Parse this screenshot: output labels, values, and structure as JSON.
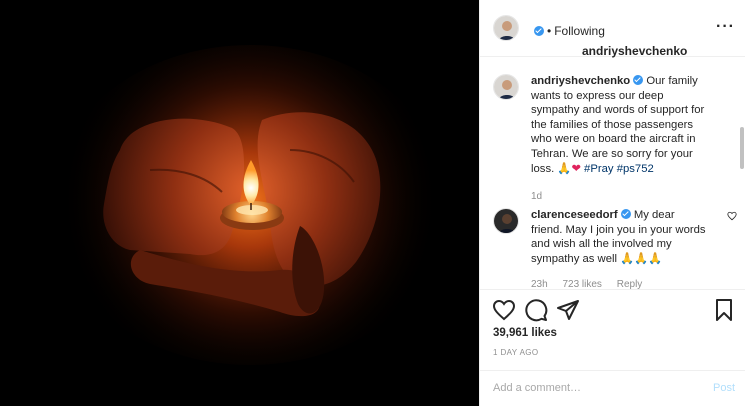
{
  "post": {
    "author": "andriyshevchenko",
    "follow_status": "Following",
    "more_icon": "more-options-icon"
  },
  "caption": {
    "author": "andriyshevchenko",
    "text": "Our family wants to express our deep sympathy and words of support for the families of those passengers who were on board the aircraft in Tehran. We are so sorry for your loss. 🙏",
    "heart": "❤",
    "hashtags": "#Pray #ps752",
    "age": "1d"
  },
  "comment": {
    "author": "clarenceseedorf",
    "text": "My dear friend. May I join you in your words and wish all the involved my sympathy as well",
    "emoji": "🙏🙏🙏",
    "age": "23h",
    "likes": "723 likes",
    "reply": "Reply"
  },
  "footer": {
    "likes": "39,961 likes",
    "age": "1 DAY AGO",
    "comment_placeholder": "Add a comment…",
    "post_label": "Post"
  },
  "colors": {
    "link_blue": "#003569",
    "verified_blue": "#3897f0",
    "post_disabled": "#b2dffc",
    "muted": "#8e8e8e"
  }
}
